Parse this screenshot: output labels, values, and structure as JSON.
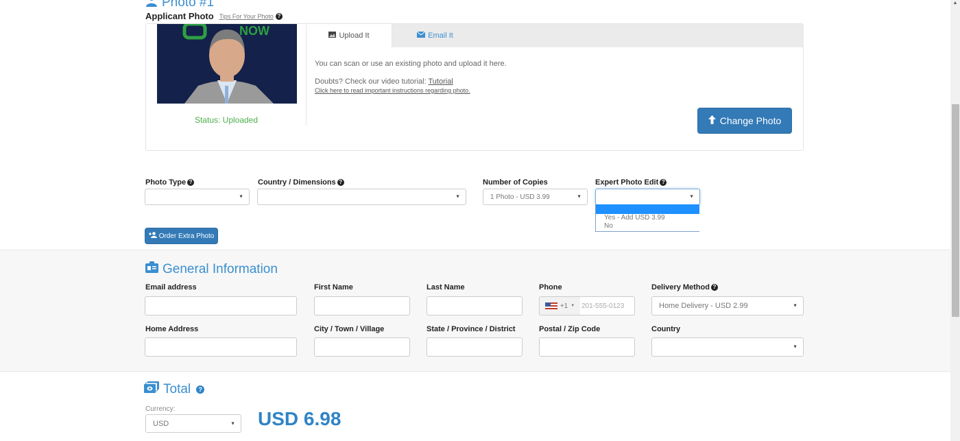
{
  "photo_section": {
    "title": "Photo #1",
    "applicant_label": "Applicant Photo",
    "tips_link": "Tips For Your Photo",
    "status": "Status: Uploaded",
    "tabs": [
      {
        "label": "Upload It",
        "icon": "image-icon",
        "active": true
      },
      {
        "label": "Email It",
        "icon": "envelope-icon",
        "active": false
      }
    ],
    "upload_text": "You can scan or use an existing photo and upload it here.",
    "doubts_text": "Doubts? Check our video tutorial: ",
    "tutorial_link": "Tutorial",
    "instructions_link": "Click here to read important instructions regarding photo.",
    "change_photo_button": "Change Photo"
  },
  "photo_options": {
    "photo_type": {
      "label": "Photo Type",
      "value": ""
    },
    "country_dimensions": {
      "label": "Country / Dimensions",
      "value": ""
    },
    "copies": {
      "label": "Number of Copies",
      "value": "1 Photo - USD 3.99"
    },
    "expert_edit": {
      "label": "Expert Photo Edit",
      "value": "",
      "options": [
        "",
        "Yes - Add USD 3.99",
        "No"
      ]
    },
    "order_extra_button": "Order Extra Photo"
  },
  "general": {
    "title": "General Information",
    "email": {
      "label": "Email address",
      "value": ""
    },
    "first_name": {
      "label": "First Name",
      "value": ""
    },
    "last_name": {
      "label": "Last Name",
      "value": ""
    },
    "phone": {
      "label": "Phone",
      "country_code": "+1",
      "placeholder": "201-555-0123"
    },
    "delivery": {
      "label": "Delivery Method",
      "value": "Home Delivery - USD 2.99"
    },
    "home_address": {
      "label": "Home Address",
      "value": ""
    },
    "city": {
      "label": "City / Town / Village",
      "value": ""
    },
    "state": {
      "label": "State / Province / District",
      "value": ""
    },
    "postal": {
      "label": "Postal / Zip Code",
      "value": ""
    },
    "country": {
      "label": "Country",
      "value": ""
    }
  },
  "total": {
    "title": "Total",
    "currency_label": "Currency:",
    "currency_value": "USD",
    "amount": "USD 6.98"
  },
  "colors": {
    "accent": "#3a8fd0",
    "button": "#337ab7",
    "status_ok": "#4cae4c",
    "amount": "#2f84c6"
  }
}
